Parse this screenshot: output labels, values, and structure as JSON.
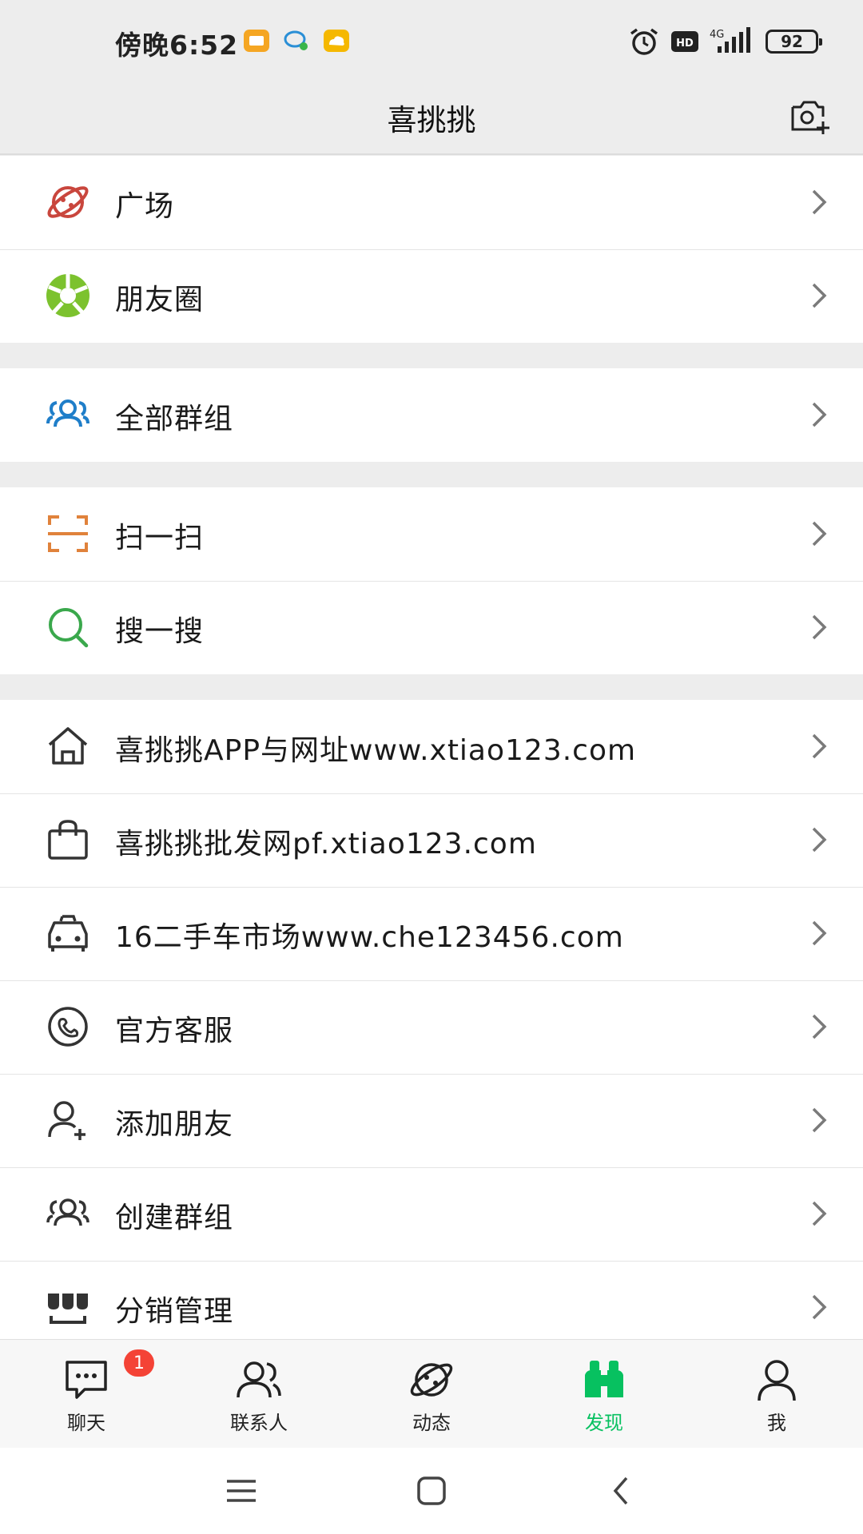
{
  "status_bar": {
    "time": "傍晚6:52",
    "network": "4G",
    "hd": "HD",
    "battery": "92"
  },
  "header": {
    "title": "喜挑挑"
  },
  "groups": [
    {
      "items": [
        {
          "label": "广场",
          "icon": "planet-icon",
          "color": "#c9463d"
        },
        {
          "label": "朋友圈",
          "icon": "moments-icon",
          "color": "#7cc22e"
        }
      ]
    },
    {
      "items": [
        {
          "label": "全部群组",
          "icon": "group-icon",
          "color": "#1f7ec9"
        }
      ]
    },
    {
      "items": [
        {
          "label": "扫一扫",
          "icon": "scan-icon",
          "color": "#e0823b"
        },
        {
          "label": "搜一搜",
          "icon": "search-icon",
          "color": "#3aa84c"
        }
      ]
    },
    {
      "items": [
        {
          "label": "喜挑挑APP与网址www.xtiao123.com",
          "icon": "home-icon",
          "color": "#333333"
        },
        {
          "label": "喜挑挑批发网pf.xtiao123.com",
          "icon": "shopping-bag-icon",
          "color": "#333333"
        },
        {
          "label": "16二手车市场www.che123456.com",
          "icon": "car-icon",
          "color": "#333333"
        },
        {
          "label": "官方客服",
          "icon": "headset-icon",
          "color": "#333333"
        },
        {
          "label": "添加朋友",
          "icon": "add-friend-icon",
          "color": "#333333"
        },
        {
          "label": "创建群组",
          "icon": "create-group-icon",
          "color": "#333333"
        },
        {
          "label": "分销管理",
          "icon": "distribution-icon",
          "color": "#333333"
        }
      ]
    }
  ],
  "tabs": [
    {
      "label": "聊天",
      "icon": "chat-icon",
      "badge": "1"
    },
    {
      "label": "联系人",
      "icon": "contacts-icon"
    },
    {
      "label": "动态",
      "icon": "planet-icon"
    },
    {
      "label": "发现",
      "icon": "binoculars-icon",
      "active": true
    },
    {
      "label": "我",
      "icon": "person-icon"
    }
  ],
  "colors": {
    "accent": "#07c160",
    "badge": "#f44336",
    "background": "#ededed"
  }
}
